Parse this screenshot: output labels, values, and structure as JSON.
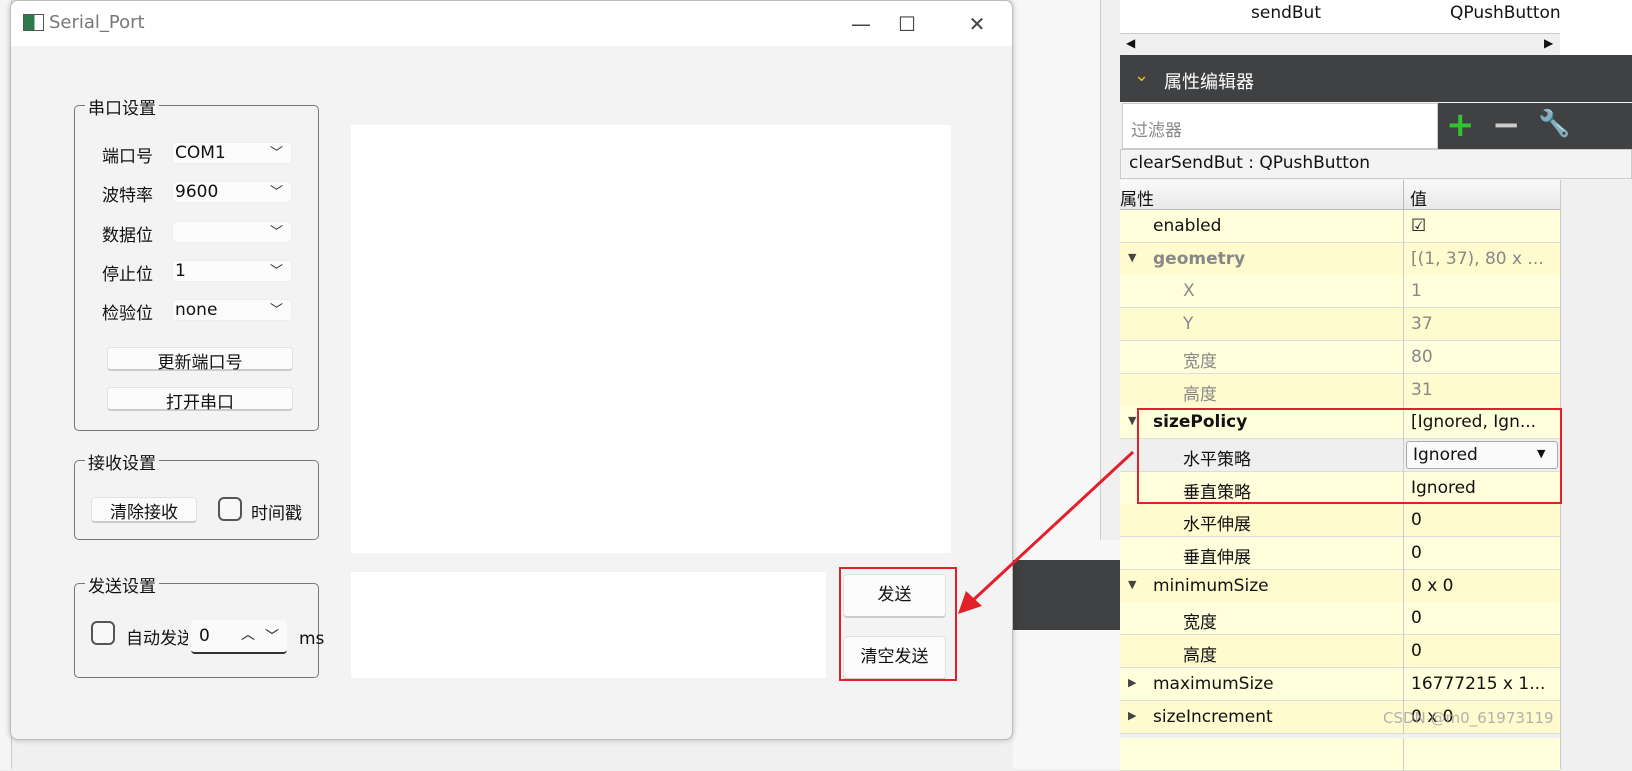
{
  "window": {
    "title": "Serial_Port",
    "minimize": "—",
    "maximize": "☐",
    "close": "✕"
  },
  "serial_group": {
    "title": "串口设置",
    "rows": [
      {
        "label": "端口号",
        "value": "COM1"
      },
      {
        "label": "波特率",
        "value": "9600"
      },
      {
        "label": "数据位",
        "value": ""
      },
      {
        "label": "停止位",
        "value": "1"
      },
      {
        "label": "检验位",
        "value": "none"
      }
    ],
    "refresh_button": "更新端口号",
    "open_button": "打开串口"
  },
  "receive_group": {
    "title": "接收设置",
    "clear_button": "清除接收",
    "timestamp_label": "时间戳",
    "timestamp_checked": false
  },
  "send_group": {
    "title": "发送设置",
    "auto_label": "自动发送",
    "auto_checked": false,
    "interval": "0",
    "unit": "ms"
  },
  "send_button": "发送",
  "clear_send_button": "清空发送",
  "object_inspector": {
    "row_name": "sendBut",
    "row_class": "QPushButton"
  },
  "property_editor": {
    "title": "属性编辑器",
    "filter_placeholder": "过滤器",
    "object": "clearSendBut : QPushButton",
    "col_property": "属性",
    "col_value": "值",
    "rows": [
      {
        "name": "enabled",
        "value": "☑",
        "indent": 1
      },
      {
        "name": "geometry",
        "value": "[(1, 37), 80 x ...",
        "indent": 1,
        "expander": "open",
        "grey": true,
        "bold": true
      },
      {
        "name": "X",
        "value": "1",
        "indent": 2,
        "grey": true
      },
      {
        "name": "Y",
        "value": "37",
        "indent": 2,
        "grey": true
      },
      {
        "name": "宽度",
        "value": "80",
        "indent": 2,
        "grey": true
      },
      {
        "name": "高度",
        "value": "31",
        "indent": 2,
        "grey": true
      },
      {
        "name": "sizePolicy",
        "value": "[Ignored, Ign...",
        "indent": 1,
        "expander": "open",
        "bold": true
      },
      {
        "name": "水平策略",
        "value": "Ignored",
        "indent": 2,
        "selected": true,
        "dropdown": true
      },
      {
        "name": "垂直策略",
        "value": "Ignored",
        "indent": 2
      },
      {
        "name": "水平伸展",
        "value": "0",
        "indent": 2
      },
      {
        "name": "垂直伸展",
        "value": "0",
        "indent": 2
      },
      {
        "name": "minimumSize",
        "value": "0 x 0",
        "indent": 1,
        "expander": "open"
      },
      {
        "name": "宽度",
        "value": "0",
        "indent": 2
      },
      {
        "name": "高度",
        "value": "0",
        "indent": 2
      },
      {
        "name": "maximumSize",
        "value": "16777215 x 1...",
        "indent": 1,
        "expander": "closed"
      },
      {
        "name": "sizeIncrement",
        "value": "0 x 0",
        "indent": 1,
        "expander": "closed"
      }
    ]
  },
  "watermark": "CSDN @m0_61973119",
  "colors": {
    "highlight": "#e3202a",
    "row_yellow": "#ffffdc",
    "row_yellow_alt": "#fffbcf",
    "dark_panel": "#404143"
  }
}
